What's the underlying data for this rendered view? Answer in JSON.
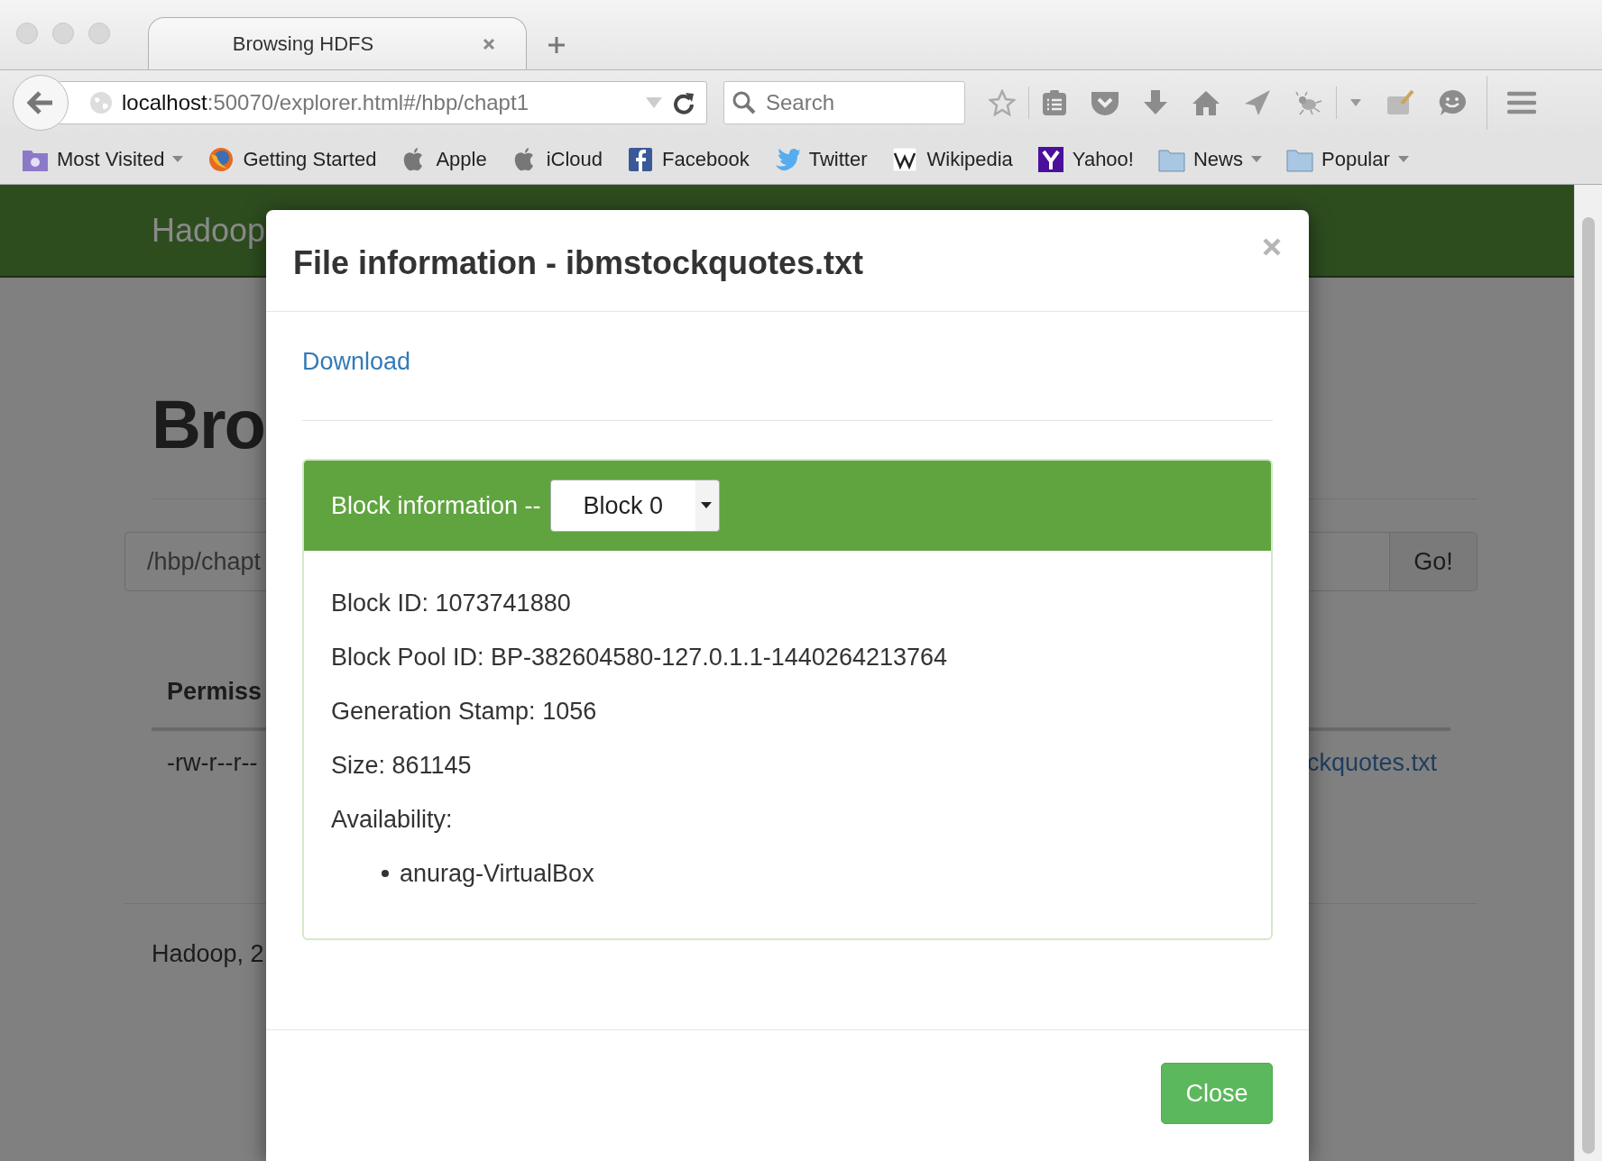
{
  "tabs": [
    {
      "title": "Browsing HDFS",
      "selected": true
    }
  ],
  "address_bar": {
    "host": "localhost",
    "rest": ":50070/explorer.html#/hbp/chapt1"
  },
  "search": {
    "placeholder": "Search"
  },
  "bookmarks": [
    {
      "label": "Most Visited",
      "kind": "smart",
      "dropdown": true
    },
    {
      "label": "Getting Started",
      "kind": "firefox",
      "dropdown": false
    },
    {
      "label": "Apple",
      "kind": "apple",
      "dropdown": false
    },
    {
      "label": "iCloud",
      "kind": "apple",
      "dropdown": false
    },
    {
      "label": "Facebook",
      "kind": "facebook",
      "dropdown": false
    },
    {
      "label": "Twitter",
      "kind": "twitter",
      "dropdown": false
    },
    {
      "label": "Wikipedia",
      "kind": "wikipedia",
      "dropdown": false
    },
    {
      "label": "Yahoo!",
      "kind": "yahoo",
      "dropdown": false
    },
    {
      "label": "News",
      "kind": "folder",
      "dropdown": true
    },
    {
      "label": "Popular",
      "kind": "folder",
      "dropdown": true
    }
  ],
  "page": {
    "brand": "Hadoop",
    "heading": "Bro",
    "path_input": "/hbp/chapt",
    "go_button": "Go!",
    "column_header": "Permiss",
    "row": {
      "permission": "-rw-r--r--",
      "file_link": "ckquotes.txt"
    },
    "footer": "Hadoop, 2"
  },
  "modal": {
    "title": "File information - ibmstockquotes.txt",
    "download_link": "Download",
    "block_panel": {
      "heading": "Block information --",
      "select_value": "Block 0",
      "fields": [
        "Block ID: 1073741880",
        "Block Pool ID: BP-382604580-127.0.1.1-1440264213764",
        "Generation Stamp: 1056",
        "Size: 861145",
        "Availability:"
      ],
      "hosts": [
        "anurag-VirtualBox"
      ]
    },
    "close_button": "Close"
  }
}
